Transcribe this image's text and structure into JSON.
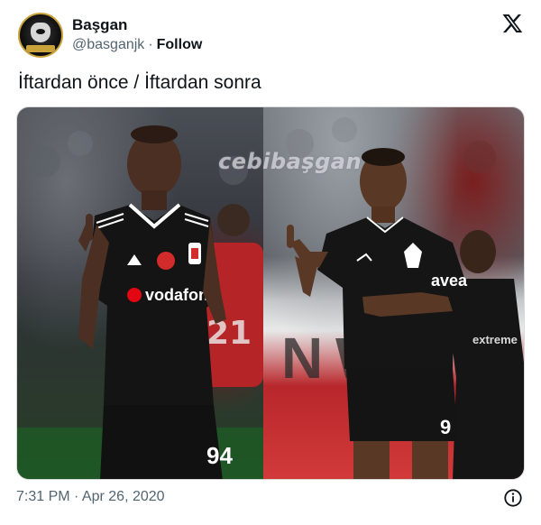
{
  "author": {
    "display_name": "Başgan",
    "handle": "@basganjk",
    "separator": "·",
    "follow_label": "Follow",
    "avatar_icon": "eagle-badge-icon"
  },
  "tweet": {
    "text": "İftardan önce / İftardan sonra"
  },
  "media": {
    "watermark": "cebibaşgan",
    "left_photo": {
      "sponsor_text": "vodafone",
      "shirt_number": "94"
    },
    "right_photo": {
      "sponsor_text": "avea",
      "shirt_number": "9",
      "bystander_shirt_text": "extreme"
    }
  },
  "footer": {
    "timestamp": "7:31 PM · Apr 26, 2020",
    "info_icon": "info-circle-icon"
  },
  "colors": {
    "text_primary": "#0f1419",
    "text_secondary": "#536471",
    "kit_black": "#121212"
  }
}
